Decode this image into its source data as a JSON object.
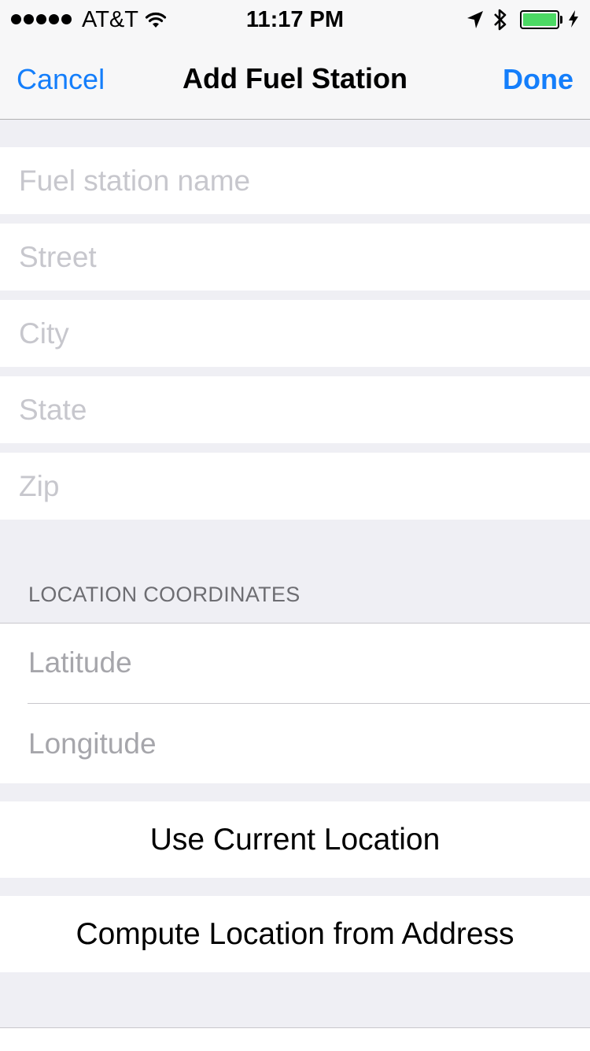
{
  "status_bar": {
    "carrier": "AT&T",
    "time": "11:17 PM",
    "battery_color": "#4cd964",
    "icons": [
      "signal-dots-icon",
      "wifi-icon",
      "location-arrow-icon",
      "bluetooth-icon",
      "battery-icon",
      "charging-bolt-icon"
    ]
  },
  "nav": {
    "cancel_label": "Cancel",
    "title": "Add Fuel Station",
    "done_label": "Done",
    "accent_color": "#147efb"
  },
  "form": {
    "name_placeholder": "Fuel station name",
    "street_placeholder": "Street",
    "city_placeholder": "City",
    "state_placeholder": "State",
    "zip_placeholder": "Zip"
  },
  "location": {
    "section_header": "LOCATION COORDINATES",
    "latitude_placeholder": "Latitude",
    "longitude_placeholder": "Longitude"
  },
  "actions": {
    "use_current_location": "Use Current Location",
    "compute_from_address": "Compute Location from Address"
  }
}
